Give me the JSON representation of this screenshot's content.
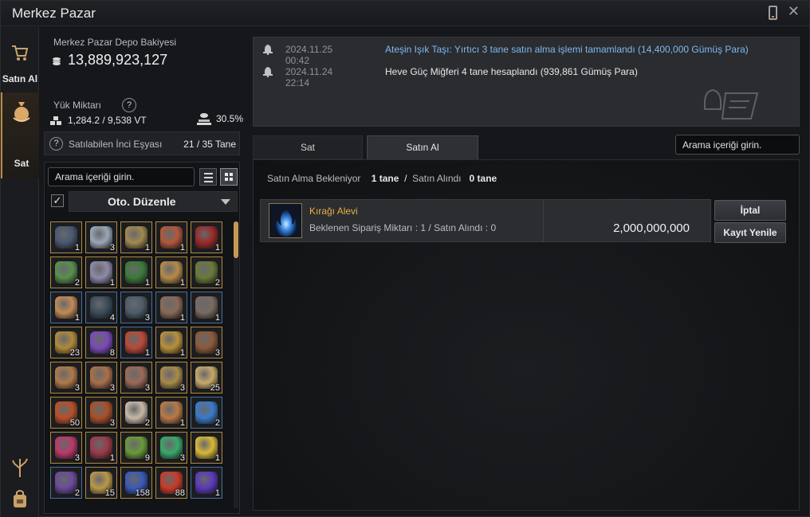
{
  "window": {
    "title": "Merkez Pazar"
  },
  "nav": {
    "buy_label": "Satın Al",
    "sell_label": "Sat"
  },
  "wallet": {
    "deposit_label": "Merkez Pazar Depo Bakiyesi",
    "deposit_value": "13,889,923,127",
    "weight_label": "Yük Miktarı",
    "weight_help": "?",
    "weight_value": "1,284.2 / 9,538",
    "weight_unit": "VT",
    "weight_percent": "30.5%"
  },
  "pearl": {
    "help": "?",
    "label": "Satılabilen İnci Eşyası",
    "count": "21 / 35 Tane"
  },
  "inventory": {
    "search_placeholder": "Arama içeriği girin.",
    "auto_sort_checked": "✓",
    "auto_sort_label": "Oto. Düzenle",
    "slots": [
      {
        "icon": "armor-icon",
        "count": "1",
        "color": "#4a5870",
        "frame": "gold"
      },
      {
        "icon": "ring-icon",
        "count": "3",
        "color": "#9aa6b8",
        "frame": "gold"
      },
      {
        "icon": "necklace-icon",
        "count": "1",
        "color": "#a08a50",
        "frame": "gold"
      },
      {
        "icon": "crown-icon",
        "count": "1",
        "color": "#b0583a",
        "frame": "gold"
      },
      {
        "icon": "red-ring-icon",
        "count": "1",
        "color": "#9a2a2a",
        "frame": "gold"
      },
      {
        "icon": "gem-ring-icon",
        "count": "2",
        "color": "#5a8f4e",
        "frame": "gold"
      },
      {
        "icon": "silver-crown-icon",
        "count": "1",
        "color": "#8e8aa8",
        "frame": "gold"
      },
      {
        "icon": "green-belt-icon",
        "count": "1",
        "color": "#3c7a3a",
        "frame": "gold"
      },
      {
        "icon": "dagger-icon",
        "count": "1",
        "color": "#b58a4a",
        "frame": "gold"
      },
      {
        "icon": "claw-icon",
        "count": "2",
        "color": "#6a7a3a",
        "frame": "gold"
      },
      {
        "icon": "wood-stick-icon",
        "count": "1",
        "color": "#c08a58",
        "frame": "blue"
      },
      {
        "icon": "pickaxe-icon",
        "count": "4",
        "color": "#3a4c5a",
        "frame": "blue"
      },
      {
        "icon": "knife-icon",
        "count": "3",
        "color": "#4c5c6a",
        "frame": "blue"
      },
      {
        "icon": "fishing-rod-icon",
        "count": "1",
        "color": "#8a6a58",
        "frame": "blue"
      },
      {
        "icon": "fishing-rod-icon",
        "count": "1",
        "color": "#7a6a60",
        "frame": "blue"
      },
      {
        "icon": "horn-icon",
        "count": "23",
        "color": "#b08a3a",
        "frame": "gold"
      },
      {
        "icon": "purple-crystal-icon",
        "count": "8",
        "color": "#7a4ab8",
        "frame": "gold"
      },
      {
        "icon": "scroll-icon",
        "count": "1",
        "color": "#b84a3a",
        "frame": "blue"
      },
      {
        "icon": "feast-icon",
        "count": "1",
        "color": "#b8903a",
        "frame": "gold"
      },
      {
        "icon": "potion-box-icon",
        "count": "3",
        "color": "#8a5a3a",
        "frame": "gold"
      },
      {
        "icon": "stew-icon",
        "count": "3",
        "color": "#b07a4a",
        "frame": "gold"
      },
      {
        "icon": "stew-icon",
        "count": "3",
        "color": "#a8704a",
        "frame": "gold"
      },
      {
        "icon": "meal-icon",
        "count": "3",
        "color": "#9a6a58",
        "frame": "gold"
      },
      {
        "icon": "meal-icon",
        "count": "3",
        "color": "#a88a4a",
        "frame": "gold"
      },
      {
        "icon": "soup-icon",
        "count": "25",
        "color": "#c8a86a",
        "frame": "gold"
      },
      {
        "icon": "red-soup-icon",
        "count": "50",
        "color": "#b8502a",
        "frame": "gold"
      },
      {
        "icon": "red-soup-icon",
        "count": "3",
        "color": "#a8502a",
        "frame": "gold"
      },
      {
        "icon": "platter-icon",
        "count": "2",
        "color": "#c8b8a8",
        "frame": "gold"
      },
      {
        "icon": "platter-icon",
        "count": "1",
        "color": "#b87a48",
        "frame": "gold"
      },
      {
        "icon": "blue-elixir-icon",
        "count": "2",
        "color": "#3a7ac8",
        "frame": "blue"
      },
      {
        "icon": "pink-elixir-icon",
        "count": "3",
        "color": "#b83a6a",
        "frame": "gold"
      },
      {
        "icon": "red-elixir-icon",
        "count": "1",
        "color": "#9a3a4a",
        "frame": "gold"
      },
      {
        "icon": "green-elixir-icon",
        "count": "9",
        "color": "#6a9a3a",
        "frame": "gold"
      },
      {
        "icon": "green-flask-icon",
        "count": "3",
        "color": "#3aa86a",
        "frame": "gold"
      },
      {
        "icon": "sunflower-icon",
        "count": "1",
        "color": "#d8b83a",
        "frame": "gold"
      },
      {
        "icon": "purple-potion-icon",
        "count": "2",
        "color": "#6a4a9a",
        "frame": "blue"
      },
      {
        "icon": "nuts-icon",
        "count": "15",
        "color": "#b8984a",
        "frame": "gold"
      },
      {
        "icon": "blue-orb-icon",
        "count": "158",
        "color": "#3a5ab8",
        "frame": "gold"
      },
      {
        "icon": "red-orb-icon",
        "count": "88",
        "color": "#c83a2a",
        "frame": "gold"
      },
      {
        "icon": "purple-gem-icon",
        "count": "1",
        "color": "#5a3ab8",
        "frame": "blue"
      }
    ]
  },
  "notifications": [
    {
      "time": "2024.11.25 00:42",
      "text": "Ateşin Işık Taşı: Yırtıcı 3 tane satın alma işlemi tamamlandı (14,400,000 Gümüş Para)"
    },
    {
      "time": "2024.11.24 22:14",
      "text": "Heve Güç Miğferi 4 tane hesaplandı (939,861 Gümüş Para)"
    }
  ],
  "market": {
    "tab_sell": "Sat",
    "tab_buy": "Satın Al",
    "search_placeholder": "Arama içeriği girin.",
    "pending_label": "Satın Alma Bekleniyor",
    "pending_count": "1 tane",
    "separator": "/",
    "bought_label": "Satın Alındı",
    "bought_count": "0 tane",
    "order": {
      "name": "Kırağı Alevi",
      "detail": "Beklenen Sipariş Miktarı : 1 / Satın Alındı : 0",
      "price": "2,000,000,000",
      "cancel_label": "İptal",
      "renew_label": "Kayıt Yenile"
    }
  },
  "colors": {
    "accent_gold": "#e5b145",
    "notif_blue": "#7fb8f0",
    "panel_bg": "#15171a"
  }
}
